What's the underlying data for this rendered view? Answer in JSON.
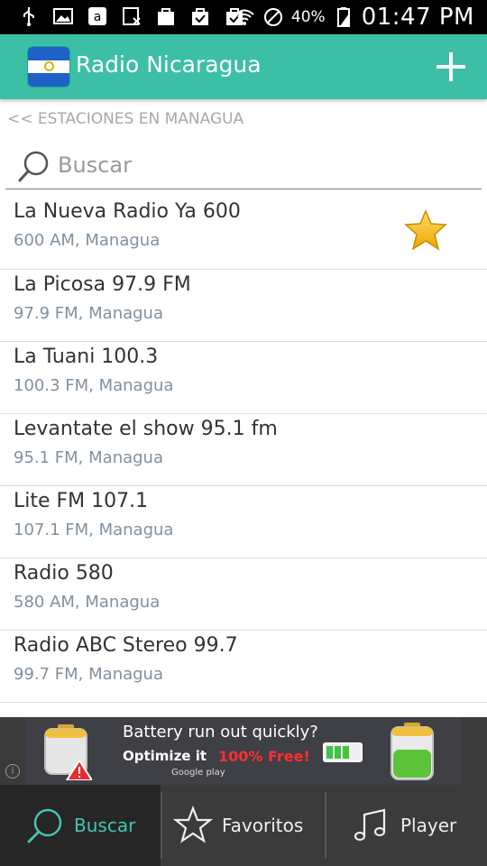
{
  "status_bar": {
    "battery_percent": "40%",
    "time": "01:47 PM"
  },
  "app_bar": {
    "title": "Radio Nicaragua"
  },
  "breadcrumb": "<< ESTACIONES EN MANAGUA",
  "search": {
    "placeholder": "Buscar"
  },
  "stations": [
    {
      "name": "La Nueva Radio Ya 600",
      "details": "600 AM, Managua",
      "favorite": true
    },
    {
      "name": "La Picosa 97.9 FM",
      "details": "97.9 FM, Managua",
      "favorite": false
    },
    {
      "name": "La Tuani 100.3",
      "details": "100.3 FM, Managua",
      "favorite": false
    },
    {
      "name": "Levantate el show 95.1 fm",
      "details": "95.1 FM, Managua",
      "favorite": false
    },
    {
      "name": "Lite FM 107.1",
      "details": "107.1 FM, Managua",
      "favorite": false
    },
    {
      "name": "Radio 580",
      "details": "580 AM, Managua",
      "favorite": false
    },
    {
      "name": "Radio ABC Stereo 99.7",
      "details": "99.7 FM, Managua",
      "favorite": false
    }
  ],
  "ad": {
    "line1": "Battery run out quickly?",
    "line2a": "Optimize it",
    "line2b": "100% Free!",
    "store": "Google play"
  },
  "bottom_nav": {
    "buscar": "Buscar",
    "favoritos": "Favoritos",
    "player": "Player"
  },
  "colors": {
    "accent": "#3dbfa6",
    "active_tab_text": "#49c2b0",
    "star": "#f5b50c"
  }
}
